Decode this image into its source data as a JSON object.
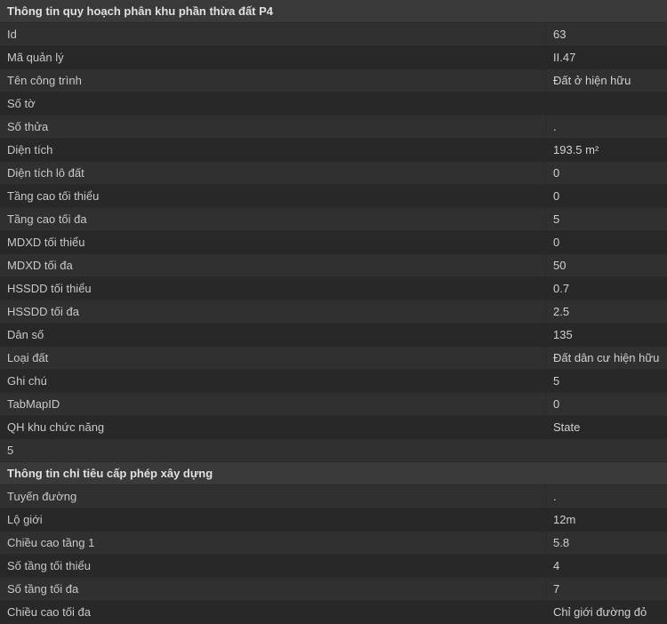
{
  "section1": {
    "title": "Thông tin quy hoạch phân khu phần thừa đất P4",
    "rows": [
      {
        "label": "Id",
        "value": "63"
      },
      {
        "label": "Mã quản lý",
        "value": "II.47"
      },
      {
        "label": "Tên công trình",
        "value": "Đất ở hiện hữu"
      },
      {
        "label": "Số tờ",
        "value": ""
      },
      {
        "label": "Số thửa",
        "value": "."
      },
      {
        "label": "Diện tích",
        "value": "193.5 m²"
      },
      {
        "label": "Diện tích lô đất",
        "value": "0"
      },
      {
        "label": "Tầng cao tối thiểu",
        "value": "0"
      },
      {
        "label": "Tầng cao tối đa",
        "value": "5"
      },
      {
        "label": "MDXD tối thiểu",
        "value": "0"
      },
      {
        "label": "MDXD tối đa",
        "value": "50"
      },
      {
        "label": "HSSDD tối thiểu",
        "value": "0.7"
      },
      {
        "label": "HSSDD tối đa",
        "value": "2.5"
      },
      {
        "label": "Dân số",
        "value": "135"
      },
      {
        "label": "Loại đất",
        "value": "Đất dân cư hiện hữu"
      },
      {
        "label": "Ghi chú",
        "value": "5"
      },
      {
        "label": "TabMapID",
        "value": "0"
      },
      {
        "label": "QH khu chức năng",
        "value": "State"
      }
    ],
    "footer": "5"
  },
  "section2": {
    "title": "Thông tin chỉ tiêu cấp phép xây dựng",
    "rows": [
      {
        "label": "Tuyến đường",
        "value": "."
      },
      {
        "label": "Lộ giới",
        "value": "12m"
      },
      {
        "label": "Chiều cao tầng 1",
        "value": "5.8"
      },
      {
        "label": "Số tầng tối thiểu",
        "value": "4"
      },
      {
        "label": "Số tầng tối đa",
        "value": "7"
      },
      {
        "label": "Chiều cao tối đa",
        "value": "Chỉ giới đường đỏ"
      }
    ]
  }
}
